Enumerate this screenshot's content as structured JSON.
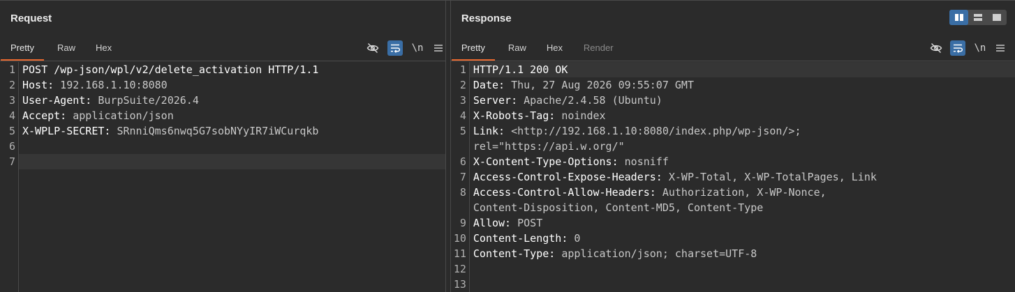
{
  "request": {
    "title": "Request",
    "tabs": [
      "Pretty",
      "Raw",
      "Hex"
    ],
    "newline_label": "\\n",
    "lines": [
      {
        "n": "1",
        "k": "POST /wp-json/wpl/v2/delete_activation HTTP/1.1",
        "v": ""
      },
      {
        "n": "2",
        "k": "Host:",
        "v": " 192.168.1.10:8080"
      },
      {
        "n": "3",
        "k": "User-Agent:",
        "v": " BurpSuite/2026.4"
      },
      {
        "n": "4",
        "k": "Accept:",
        "v": " application/json"
      },
      {
        "n": "5",
        "k": "X-WPLP-SECRET:",
        "v": " SRnniQms6nwq5G7sobNYyIR7iWCurqkb"
      },
      {
        "n": "6",
        "k": "",
        "v": ""
      },
      {
        "n": "7",
        "k": "",
        "v": ""
      }
    ]
  },
  "response": {
    "title": "Response",
    "tabs": [
      "Pretty",
      "Raw",
      "Hex",
      "Render"
    ],
    "newline_label": "\\n",
    "lines": [
      {
        "n": "1",
        "k": "HTTP/1.1 200 OK",
        "v": ""
      },
      {
        "n": "2",
        "k": "Date:",
        "v": " Thu, 27 Aug 2026 09:55:07 GMT"
      },
      {
        "n": "3",
        "k": "Server:",
        "v": " Apache/2.4.58 (Ubuntu)"
      },
      {
        "n": "4",
        "k": "X-Robots-Tag:",
        "v": " noindex"
      },
      {
        "n": "5",
        "k": "Link:",
        "v": " <http://192.168.1.10:8080/index.php/wp-json/>;"
      },
      {
        "n": "",
        "k": "",
        "v": "rel=\"https://api.w.org/\""
      },
      {
        "n": "6",
        "k": "X-Content-Type-Options:",
        "v": " nosniff"
      },
      {
        "n": "7",
        "k": "Access-Control-Expose-Headers:",
        "v": " X-WP-Total, X-WP-TotalPages, Link"
      },
      {
        "n": "8",
        "k": "Access-Control-Allow-Headers:",
        "v": " Authorization, X-WP-Nonce,"
      },
      {
        "n": "",
        "k": "",
        "v": "Content-Disposition, Content-MD5, Content-Type"
      },
      {
        "n": "9",
        "k": "Allow:",
        "v": " POST"
      },
      {
        "n": "10",
        "k": "Content-Length:",
        "v": " 0"
      },
      {
        "n": "11",
        "k": "Content-Type:",
        "v": " application/json; charset=UTF-8"
      },
      {
        "n": "12",
        "k": "",
        "v": ""
      },
      {
        "n": "13",
        "k": "",
        "v": ""
      }
    ]
  },
  "icons": {
    "hide": "eye-slash-icon",
    "wrap": "word-wrap-icon",
    "menu": "hamburger-menu-icon",
    "layout": [
      "layout-side-by-side-icon",
      "layout-stacked-icon",
      "layout-single-icon"
    ]
  },
  "colors": {
    "accent_tab": "#e8692f",
    "toggle_on": "#3a6ea5"
  }
}
